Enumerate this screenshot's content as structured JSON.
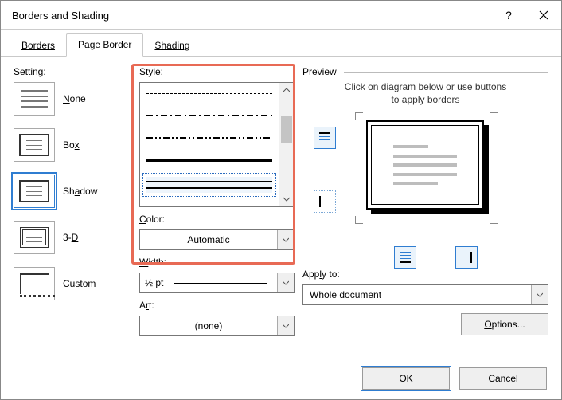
{
  "window": {
    "title": "Borders and Shading"
  },
  "tabs": {
    "borders": "Borders",
    "page_border": "Page Border",
    "shading": "Shading"
  },
  "setting": {
    "label": "Setting:",
    "none": "None",
    "box": "Box",
    "shadow": "Shadow",
    "three_d": "3-D",
    "custom": "Custom",
    "selected": "shadow"
  },
  "style": {
    "label": "Style:"
  },
  "color": {
    "label": "Color:",
    "value": "Automatic"
  },
  "width": {
    "label": "Width:",
    "value": "½ pt"
  },
  "art": {
    "label": "Art:",
    "value": "(none)"
  },
  "preview": {
    "label": "Preview",
    "hint1": "Click on diagram below or use buttons",
    "hint2": "to apply borders"
  },
  "apply_to": {
    "label": "Apply to:",
    "value": "Whole document"
  },
  "buttons": {
    "options": "Options...",
    "ok": "OK",
    "cancel": "Cancel"
  }
}
